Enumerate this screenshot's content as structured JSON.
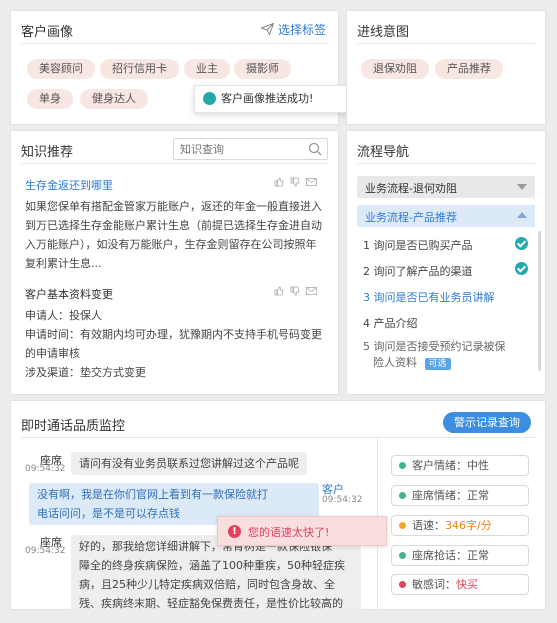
{
  "portrait": {
    "title": "客户画像",
    "select_label": "选择标签",
    "tags": [
      "美容顾问",
      "招行信用卡",
      "业主",
      "摄影师",
      "单身",
      "健身达人"
    ],
    "toast": "客户画像推送成功!"
  },
  "intent": {
    "title": "进线意图",
    "tags": [
      "退保劝阻",
      "产品推荐"
    ]
  },
  "knowledge": {
    "title": "知识推荐",
    "search_placeholder": "知识查询",
    "items": [
      {
        "title": "生存金返还到哪里",
        "body": "如果您保单有搭配金管家万能账户，返还的年金一般直接进入到万已选择生存金能账户累计生息（前提已选择生存金进自动入万能账户），如没有万能账户，生存金则留存在公司按照年复利累计生息..."
      },
      {
        "title": "客户基本资料变更",
        "lines": [
          "申请人：投保人",
          "申请时间：有效期内均可办理，犹豫期内不支持手机号码变更的申请审核",
          "涉及渠道：垫交方式变更"
        ]
      }
    ]
  },
  "flow": {
    "title": "流程导航",
    "group1": "业务流程-退何劝阻",
    "group2": "业务流程-产品推荐",
    "steps": [
      {
        "text": "1 询问是否已购买产品",
        "state": "done"
      },
      {
        "text": "2 询问了解产品的渠道",
        "state": "done"
      },
      {
        "text": "3 询问是否已有业务员讲解",
        "state": "current"
      },
      {
        "text": "4 产品介绍",
        "state": "todo"
      },
      {
        "text": "5 询问是否接受预约记录被保险人资料",
        "state": "optional"
      }
    ],
    "step5_line1": "5 询问是否接受预约记录被保",
    "step5_line2": "险人资料",
    "optional_badge": "可选"
  },
  "monitor": {
    "title": "即时通话品质监控",
    "warn_button": "警示记录查询",
    "messages": [
      {
        "role": "座席",
        "time": "09:54:32",
        "text": "请问有没有业务员联系过您讲解过这个产品呢"
      },
      {
        "role": "客户",
        "time": "09:54:32",
        "text": "没有啊，我是在你们官网上看到有一款保险就打电话问问，是不是可以存点钱"
      },
      {
        "role": "座席",
        "time": "09:54:32",
        "text": "好的，那我给您详细讲解下，常青树是一款保险银保障全的终身疾病保险，涵盖了100种重疾，50种轻症疾病，且25种少儿特定疾病双倍赔，同时包含身故、全残、疾病终末期、轻症豁免保费责任，是性价比较高的"
      }
    ],
    "agent_msg3_lines": [
      "好的，那我给您详细讲解下，常青树是一款保险银保",
      "障全的终身疾病保险，涵盖了100种重疾，50种轻症疾",
      "病，且25种少儿特定疾病双倍赔，同时包含身故、全",
      "残、疾病终末期、轻症豁免保费责任，是性价比较高的"
    ],
    "customer_msg_lines": [
      "没有啊，我是在你们官网上看到有一款保险就打",
      "电话问问，是不是可以存点钱"
    ],
    "alert": "您的语速太快了!",
    "stats": [
      {
        "label": "客户情绪：",
        "value": "中性",
        "color": "#3fb38f",
        "value_color": "#555555"
      },
      {
        "label": "座席情绪：",
        "value": "正常",
        "color": "#3fb38f",
        "value_color": "#555555"
      },
      {
        "label": "语速：",
        "value": "346字/分",
        "color": "#f5a623",
        "value_color": "#e8841a"
      },
      {
        "label": "座席抢话：",
        "value": "正常",
        "color": "#3fb38f",
        "value_color": "#555555"
      },
      {
        "label": "敏感词：",
        "value": "快买",
        "color": "#e0435b",
        "value_color": "#e0435b"
      }
    ]
  }
}
